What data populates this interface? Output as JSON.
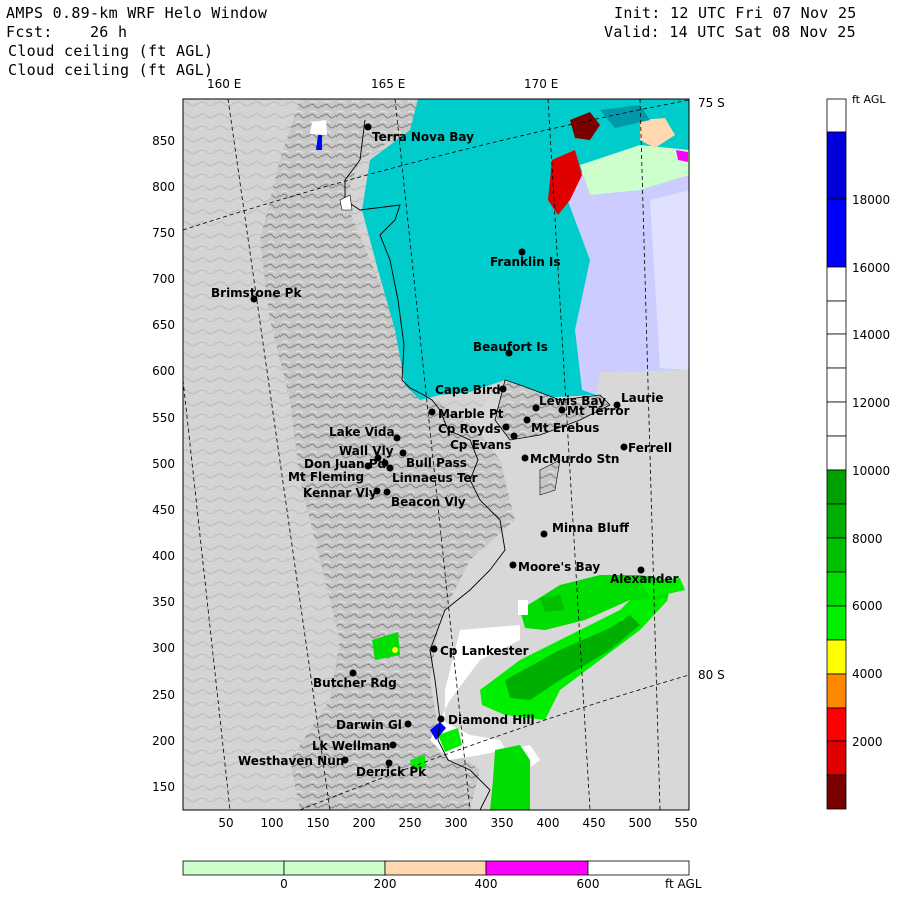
{
  "header": {
    "line1": "AMPS 0.89-km WRF Helo Window",
    "line2": "Fcst:    26 h",
    "line3": "Cloud ceiling (ft AGL)",
    "line4": "Cloud ceiling (ft AGL)",
    "init": "Init: 12 UTC Fri 07 Nov 25",
    "valid": "Valid: 14 UTC Sat 08 Nov 25"
  },
  "lon_labels": [
    "160 E",
    "165 E",
    "170 E"
  ],
  "lat_labels": [
    "75 S",
    "80 S"
  ],
  "y_ticks": [
    "850",
    "800",
    "750",
    "700",
    "650",
    "600",
    "550",
    "500",
    "450",
    "400",
    "350",
    "300",
    "250",
    "200",
    "150"
  ],
  "x_ticks": [
    "50",
    "100",
    "150",
    "200",
    "250",
    "300",
    "350",
    "400",
    "450",
    "500",
    "550"
  ],
  "colorbar": {
    "unit": "ft AGL",
    "tick_labels": [
      "18000",
      "16000",
      "14000",
      "12000",
      "10000",
      "8000",
      "6000",
      "4000",
      "2000"
    ],
    "colors": {
      "0-1000": "#7a0000",
      "1000-2000": "#e00000",
      "2000-3000": "#ff0000",
      "3000-4000": "#ff8800",
      "4000-5000": "#ffff00",
      "5000-6000": "#00ee00",
      "6000-7000": "#00dd00",
      "7000-8000": "#00c000",
      "8000-9000": "#00b000",
      "9000-10000": "#00a000",
      "10000-16000": "#ffffff",
      "16000-18000": "#0000ff",
      "18000-20000": "#0000dd"
    }
  },
  "hbar": {
    "unit": "ft AGL",
    "tick_labels": [
      "0",
      "200",
      "400",
      "600"
    ],
    "colors": {
      "below-0-a": "#ccffcc",
      "0-200": "#ccffcc",
      "200-400": "#ffd8b0",
      "400-600": "#ff00ff",
      "600-plus": "#ffffff"
    }
  },
  "map": {
    "stations": [
      "Terra Nova Bay",
      "Franklin Is",
      "Brimstone Pk",
      "Beaufort Is",
      "Cape Bird",
      "Lewis Bay",
      "Laurie",
      "Marble Pt",
      "Mt Terror",
      "Cp Royds",
      "Mt Erebus",
      "Lake Vida",
      "Cp Evans",
      "Ferrell",
      "Wall Vly",
      "McMurdo Stn",
      "Bull Pass",
      "Don Juan Pd",
      "Mt Fleming",
      "Linnaeus Ter",
      "Kennar Vly",
      "Beacon Vly",
      "Minna Bluff",
      "Moore's Bay",
      "Alexander",
      "Cp Lankester",
      "Butcher Rdg",
      "Diamond Hill",
      "Darwin Gl",
      "Lk Wellman",
      "Westhaven Nun",
      "Derrick Pk"
    ]
  }
}
